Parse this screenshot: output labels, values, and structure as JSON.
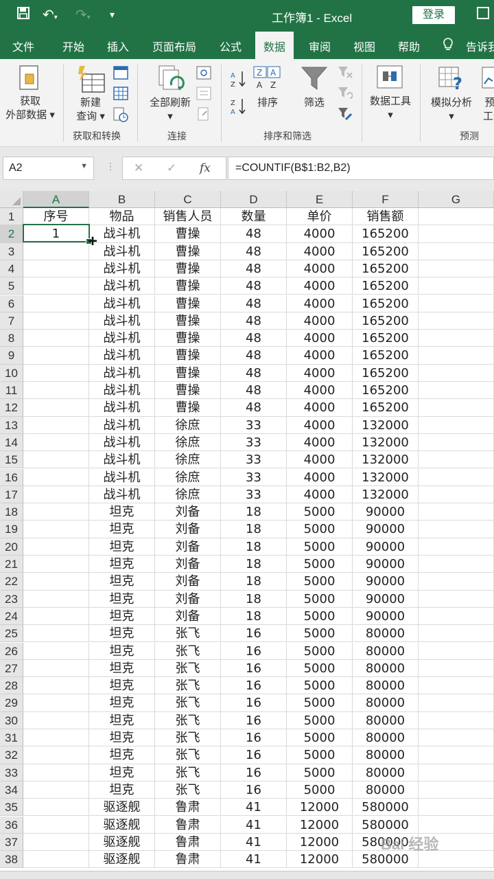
{
  "window": {
    "title": "工作簿1  -  Excel",
    "login_label": "登录"
  },
  "tabs": [
    "文件",
    "开始",
    "插入",
    "页面布局",
    "公式",
    "数据",
    "审阅",
    "视图",
    "帮助",
    "告诉我"
  ],
  "active_tab": "数据",
  "ribbon": {
    "get_external_line1": "获取",
    "get_external_line2": "外部数据",
    "new_query_line1": "新建",
    "new_query_line2": "查询",
    "refresh_all": "全部刷新",
    "sort": "排序",
    "filter": "筛选",
    "data_tools": "数据工具",
    "whatif": "模拟分析",
    "forecast_cut": "预",
    "forecast_cut2": "工作",
    "group_get_transform": "获取和转换",
    "group_connections": "连接",
    "group_sort_filter": "排序和筛选",
    "group_forecast": "预测"
  },
  "formula_bar": {
    "name_box": "A2",
    "cancel_icon": "✕",
    "enter_icon": "✓",
    "fx_label": "fx",
    "formula": "=COUNTIF(B$1:B2,B2)"
  },
  "columns": [
    "A",
    "B",
    "C",
    "D",
    "E",
    "F",
    "G"
  ],
  "selected_column": "A",
  "header_row": [
    "序号",
    "物品",
    "销售人员",
    "数量",
    "单价",
    "销售额",
    ""
  ],
  "rows": [
    [
      "1",
      "战斗机",
      "曹操",
      "48",
      "4000",
      "165200"
    ],
    [
      "",
      "战斗机",
      "曹操",
      "48",
      "4000",
      "165200"
    ],
    [
      "",
      "战斗机",
      "曹操",
      "48",
      "4000",
      "165200"
    ],
    [
      "",
      "战斗机",
      "曹操",
      "48",
      "4000",
      "165200"
    ],
    [
      "",
      "战斗机",
      "曹操",
      "48",
      "4000",
      "165200"
    ],
    [
      "",
      "战斗机",
      "曹操",
      "48",
      "4000",
      "165200"
    ],
    [
      "",
      "战斗机",
      "曹操",
      "48",
      "4000",
      "165200"
    ],
    [
      "",
      "战斗机",
      "曹操",
      "48",
      "4000",
      "165200"
    ],
    [
      "",
      "战斗机",
      "曹操",
      "48",
      "4000",
      "165200"
    ],
    [
      "",
      "战斗机",
      "曹操",
      "48",
      "4000",
      "165200"
    ],
    [
      "",
      "战斗机",
      "曹操",
      "48",
      "4000",
      "165200"
    ],
    [
      "",
      "战斗机",
      "徐庶",
      "33",
      "4000",
      "132000"
    ],
    [
      "",
      "战斗机",
      "徐庶",
      "33",
      "4000",
      "132000"
    ],
    [
      "",
      "战斗机",
      "徐庶",
      "33",
      "4000",
      "132000"
    ],
    [
      "",
      "战斗机",
      "徐庶",
      "33",
      "4000",
      "132000"
    ],
    [
      "",
      "战斗机",
      "徐庶",
      "33",
      "4000",
      "132000"
    ],
    [
      "",
      "坦克",
      "刘备",
      "18",
      "5000",
      "90000"
    ],
    [
      "",
      "坦克",
      "刘备",
      "18",
      "5000",
      "90000"
    ],
    [
      "",
      "坦克",
      "刘备",
      "18",
      "5000",
      "90000"
    ],
    [
      "",
      "坦克",
      "刘备",
      "18",
      "5000",
      "90000"
    ],
    [
      "",
      "坦克",
      "刘备",
      "18",
      "5000",
      "90000"
    ],
    [
      "",
      "坦克",
      "刘备",
      "18",
      "5000",
      "90000"
    ],
    [
      "",
      "坦克",
      "刘备",
      "18",
      "5000",
      "90000"
    ],
    [
      "",
      "坦克",
      "张飞",
      "16",
      "5000",
      "80000"
    ],
    [
      "",
      "坦克",
      "张飞",
      "16",
      "5000",
      "80000"
    ],
    [
      "",
      "坦克",
      "张飞",
      "16",
      "5000",
      "80000"
    ],
    [
      "",
      "坦克",
      "张飞",
      "16",
      "5000",
      "80000"
    ],
    [
      "",
      "坦克",
      "张飞",
      "16",
      "5000",
      "80000"
    ],
    [
      "",
      "坦克",
      "张飞",
      "16",
      "5000",
      "80000"
    ],
    [
      "",
      "坦克",
      "张飞",
      "16",
      "5000",
      "80000"
    ],
    [
      "",
      "坦克",
      "张飞",
      "16",
      "5000",
      "80000"
    ],
    [
      "",
      "坦克",
      "张飞",
      "16",
      "5000",
      "80000"
    ],
    [
      "",
      "坦克",
      "张飞",
      "16",
      "5000",
      "80000"
    ],
    [
      "",
      "驱逐舰",
      "鲁肃",
      "41",
      "12000",
      "580000"
    ],
    [
      "",
      "驱逐舰",
      "鲁肃",
      "41",
      "12000",
      "580000"
    ],
    [
      "",
      "驱逐舰",
      "鲁肃",
      "41",
      "12000",
      "580000"
    ],
    [
      "",
      "驱逐舰",
      "鲁肃",
      "41",
      "12000",
      "580000"
    ]
  ],
  "watermark": "Bai 经验"
}
